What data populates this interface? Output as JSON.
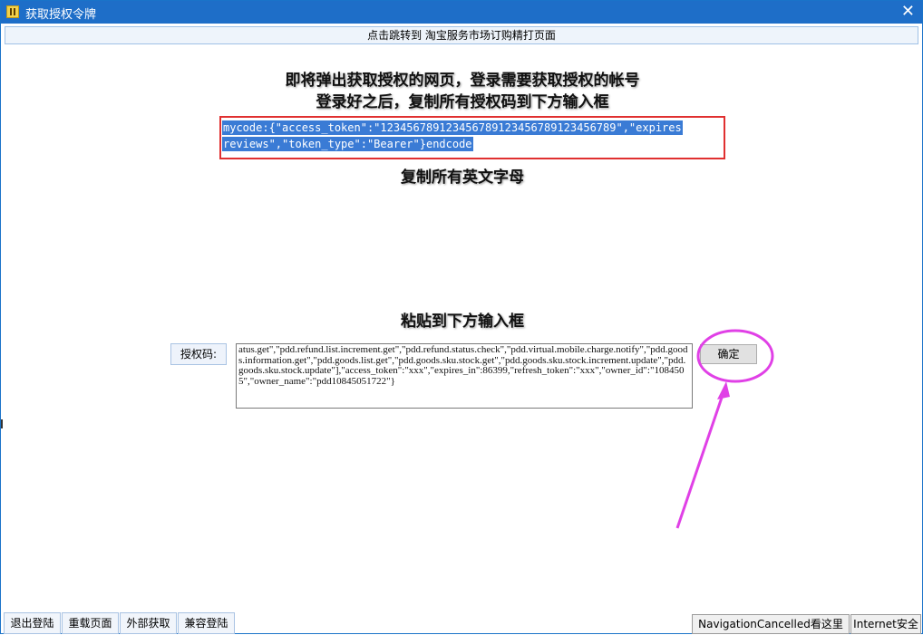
{
  "window": {
    "title": "获取授权令牌",
    "close_glyph": "✕"
  },
  "subscribe_link": "点击跳转到 淘宝服务市场订购精打页面",
  "instructions": {
    "line1": "即将弹出获取授权的网页，登录需要获取授权的帐号",
    "line2": "登录好之后，复制所有授权码到下方输入框",
    "copy_hint": "复制所有英文字母",
    "paste_hint": "粘贴到下方输入框"
  },
  "code_example": {
    "line1": "mycode:{\"access_token\":\"123456789123456789123456789123456789\",\"expires",
    "line2": "reviews\",\"token_type\":\"Bearer\"}endcode"
  },
  "auth_form": {
    "label": "授权码:",
    "value": "atus.get\",\"pdd.refund.list.increment.get\",\"pdd.refund.status.check\",\"pdd.virtual.mobile.charge.notify\",\"pdd.goods.information.get\",\"pdd.goods.list.get\",\"pdd.goods.sku.stock.get\",\"pdd.goods.sku.stock.increment.update\",\"pdd.goods.sku.stock.update\"],\"access_token\":\"xxx\",\"expires_in\":86399,\"refresh_token\":\"xxx\",\"owner_id\":\"1084505\",\"owner_name\":\"pdd10845051722\"}",
    "confirm_label": "确定"
  },
  "bottom_buttons": [
    "退出登陆",
    "重载页面",
    "外部获取",
    "兼容登陆"
  ],
  "status": {
    "navigation": "NavigationCancelled看这里",
    "zone": "Internet安全"
  },
  "colors": {
    "titlebar": "#1e6ec8",
    "highlight_border": "#e03030",
    "annotation": "#e040e6",
    "selection": "#3a7bd5"
  },
  "icons": {
    "app": "app-icon",
    "close": "close-icon"
  }
}
